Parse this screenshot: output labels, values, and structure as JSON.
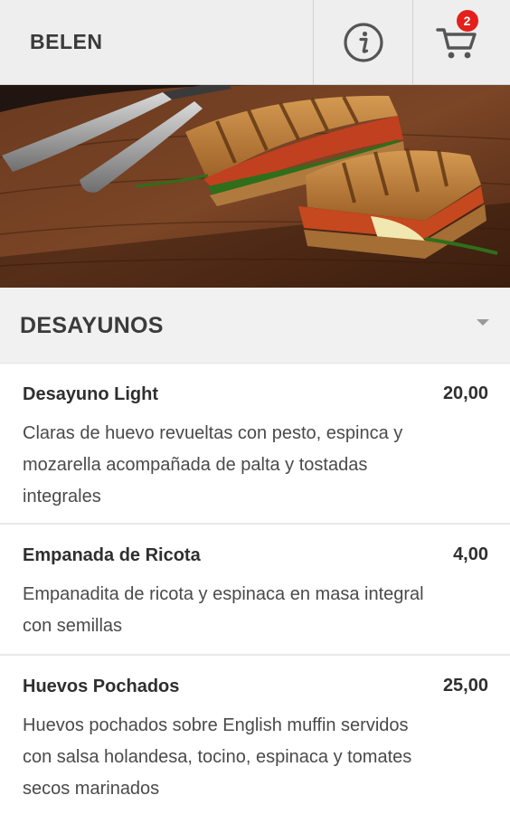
{
  "header": {
    "brand": "BELEN",
    "info_icon": "info-icon",
    "cart_icon": "cart-icon",
    "cart_count": "2",
    "badge_color": "#e3201b"
  },
  "hero": {
    "icon": "sandwich-photo"
  },
  "category": {
    "title": "DESAYUNOS",
    "toggle_icon": "caret-down-icon"
  },
  "items": [
    {
      "name": "Desayuno Light",
      "price": "20,00",
      "description": "Claras de huevo revueltas con pesto, espinca y mozarella acompañada de palta y tostadas integrales"
    },
    {
      "name": "Empanada de Ricota",
      "price": "4,00",
      "description": "Empanadita de ricota y espinaca en masa integral con semillas"
    },
    {
      "name": "Huevos Pochados",
      "price": "25,00",
      "description": "Huevos pochados sobre English muffin servidos con salsa holandesa, tocino, espinaca y tomates secos marinados"
    }
  ]
}
